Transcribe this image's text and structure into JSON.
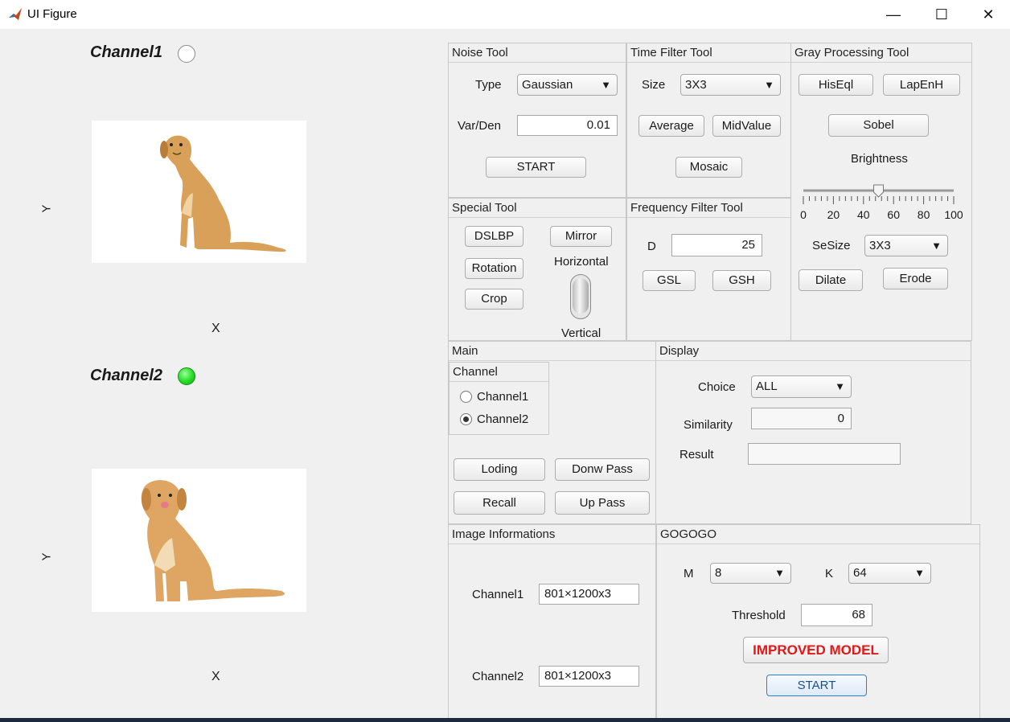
{
  "window": {
    "title": "UI Figure",
    "min_icon": "minimize-icon",
    "max_icon": "maximize-icon",
    "close_icon": "close-icon"
  },
  "left": {
    "channel1": {
      "label": "Channel1",
      "lamp": "off",
      "ylabel": "Y",
      "xlabel": "X"
    },
    "channel2": {
      "label": "Channel2",
      "lamp": "green",
      "ylabel": "Y",
      "xlabel": "X"
    }
  },
  "noise": {
    "title": "Noise Tool",
    "type_label": "Type",
    "type_value": "Gaussian",
    "var_label": "Var/Den",
    "var_value": "0.01",
    "start": "START"
  },
  "timefilter": {
    "title": "Time Filter Tool",
    "size_label": "Size",
    "size_value": "3X3",
    "average": "Average",
    "midvalue": "MidValue",
    "mosaic": "Mosaic"
  },
  "gray": {
    "title": "Gray Processing Tool",
    "hiseql": "HisEql",
    "lapenh": "LapEnH",
    "sobel": "Sobel",
    "brightness_label": "Brightness",
    "brightness_value": 50,
    "ticks": [
      "0",
      "20",
      "40",
      "60",
      "80",
      "100"
    ],
    "sesize_label": "SeSize",
    "sesize_value": "3X3",
    "dilate": "Dilate",
    "erode": "Erode"
  },
  "special": {
    "title": "Special Tool",
    "dslbp": "DSLBP",
    "rotation": "Rotation",
    "crop": "Crop",
    "mirror": "Mirror",
    "horizontal": "Horizontal",
    "vertical": "Vertical"
  },
  "freq": {
    "title": "Frequency Filter Tool",
    "d_label": "D",
    "d_value": "25",
    "gsl": "GSL",
    "gsh": "GSH"
  },
  "main": {
    "title": "Main",
    "channel_group": "Channel",
    "radio1": "Channel1",
    "radio2": "Channel2",
    "selected": "Channel2",
    "loding": "Loding",
    "donw_pass": "Donw Pass",
    "recall": "Recall",
    "up_pass": "Up Pass"
  },
  "display": {
    "title": "Display",
    "choice_label": "Choice",
    "choice_value": "ALL",
    "similarity_label": "Similarity",
    "similarity_value": "0",
    "result_label": "Result",
    "result_value": ""
  },
  "info": {
    "title": "Image Informations",
    "ch1_label": "Channel1",
    "ch1_value": "801×1200x3",
    "ch2_label": "Channel2",
    "ch2_value": "801×1200x3"
  },
  "gogogo": {
    "title": "GOGOGO",
    "m_label": "M",
    "m_value": "8",
    "k_label": "K",
    "k_value": "64",
    "threshold_label": "Threshold",
    "threshold_value": "68",
    "improved": "IMPROVED MODEL",
    "start": "START"
  },
  "colors": {
    "lamp_green": "#22dd22",
    "improved_red": "#e01818",
    "start_blue": "#2a7fd0"
  }
}
